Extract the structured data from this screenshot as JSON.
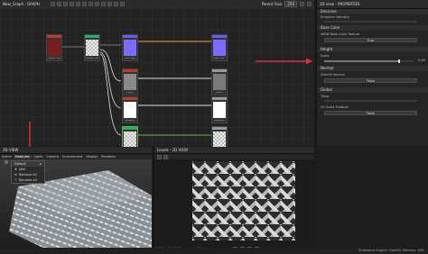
{
  "graph": {
    "title": "New_Graph - GRAPH",
    "parent_size_label": "Parent Size:",
    "parent_size_value": "256",
    "nodes": [
      {
        "id": "n1",
        "label": "Uniform Color",
        "bar": "#c0392b",
        "thumb": "#7a1d1d"
      },
      {
        "id": "n2",
        "label": "Uniform Color",
        "bar": "#27ae60",
        "thumb": "checker"
      },
      {
        "id": "n3",
        "label": "Base Color",
        "bar": "#6c5ce7",
        "thumb": "#7b6cff"
      },
      {
        "id": "n4",
        "label": "Base Color",
        "bar": "#6c5ce7",
        "thumb": "#7b6cff"
      },
      {
        "id": "n5",
        "label": "Metallic",
        "bar": "#c0392b",
        "thumb": "#8a8a8a"
      },
      {
        "id": "n6",
        "label": "Metallic",
        "bar": "#999",
        "thumb": "#7a7a7a"
      },
      {
        "id": "n7",
        "label": "Roughness",
        "bar": "#c0392b",
        "thumb": "#ffffff"
      },
      {
        "id": "n8",
        "label": "Roughness",
        "bar": "#999",
        "thumb": "#ffffff"
      },
      {
        "id": "n9",
        "label": "Normal",
        "bar": "#27ae60",
        "thumb": "checker"
      },
      {
        "id": "n10",
        "label": "Normal",
        "bar": "#999",
        "thumb": "checker"
      }
    ]
  },
  "properties": {
    "title": "3D view - PROPERTIES",
    "sections": [
      {
        "name": "Emissive"
      },
      {
        "name": "Base Color"
      },
      {
        "name": "Height"
      },
      {
        "name": "Normal"
      },
      {
        "name": "Global"
      }
    ],
    "emissive_label": "Emissive Intensity",
    "base_color_label": "sRGB Base Color Texture",
    "base_color_value": "True",
    "height_scale_label": "Scale",
    "height_scale_value": "0.25",
    "normal_label": "DirectX Normal",
    "normal_value": "False",
    "global_tiling_label": "Tiling",
    "uv_scale_label": "UV Scale Enabled",
    "uv_scale_value": "False"
  },
  "view3d": {
    "title": "3D VIEW",
    "menu_tabs": [
      "Scene",
      "Materials",
      "Lights",
      "Camera",
      "Environment",
      "Display",
      "Renderer"
    ],
    "dropdown_items": [
      "Default",
      "Add",
      "Remove All",
      "Rename All"
    ]
  },
  "view2d": {
    "title": "Levels - 2D VIEW",
    "footer": "2048 x 2048 (Grayscale, 16bpc)"
  },
  "status": {
    "text": "Substance Engine: OpenGL  Memory: 16%"
  },
  "colors": {
    "accent_red": "#e03030",
    "link_orange": "#f0a030"
  }
}
